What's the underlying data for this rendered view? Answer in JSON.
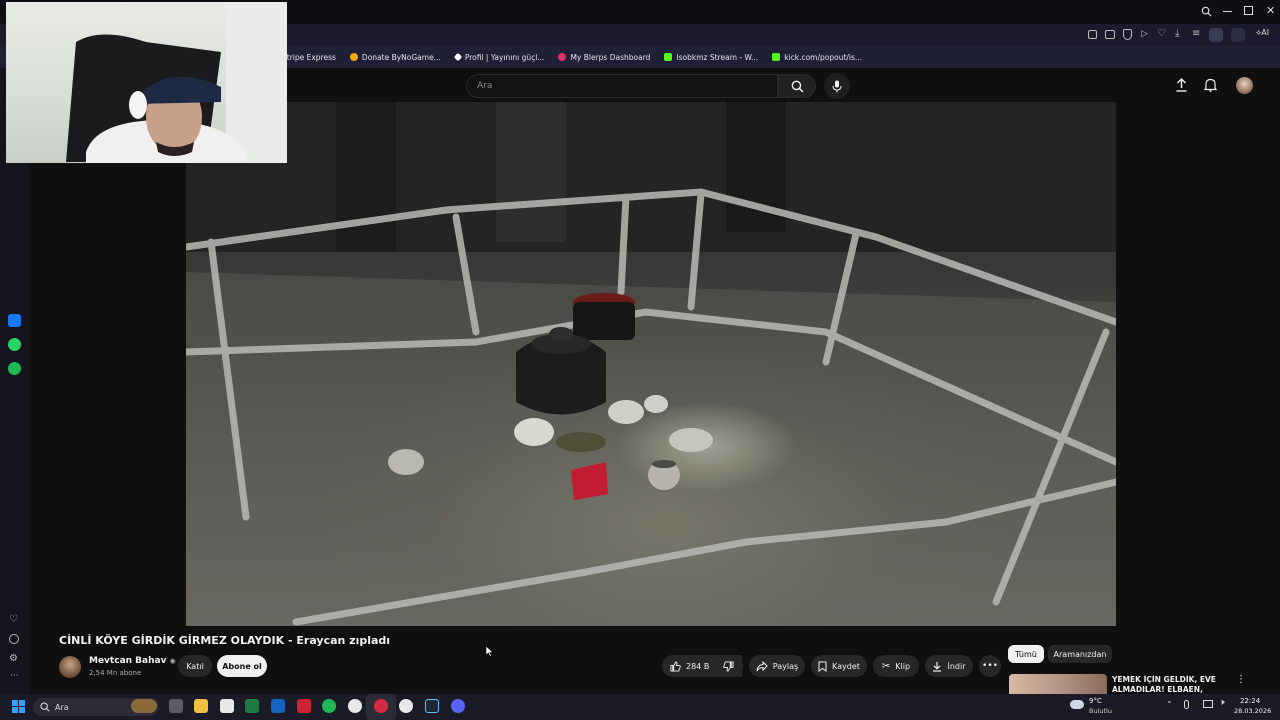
{
  "bookmarks": [
    {
      "label": "Stripe Express",
      "icon": "stripe-icon",
      "color": "#635bff"
    },
    {
      "label": "Donate ByNoGame...",
      "icon": "bynogame-icon",
      "color": "#f2a900"
    },
    {
      "label": "Profil | Yayınını güçl...",
      "icon": "profile-icon",
      "color": "#ffffff"
    },
    {
      "label": "My Blerps Dashboard",
      "icon": "blerp-icon",
      "color": "#e0306a"
    },
    {
      "label": "Isobkmz Stream - W...",
      "icon": "kick-icon",
      "color": "#53fc18"
    },
    {
      "label": "kick.com/popout/is...",
      "icon": "kick-icon",
      "color": "#53fc18"
    }
  ],
  "search": {
    "placeholder": "Ara"
  },
  "video": {
    "title": "CİNLİ KÖYE GİRDİK GİRMEZ OLAYDIK - Eraycan zıpladı"
  },
  "channel": {
    "name": "Mevtcan Bahav",
    "subscribers": "2,54 Mn abone",
    "join_label": "Katıl",
    "subscribe_label": "Abone ol"
  },
  "actions": {
    "likes": "284 B",
    "share": "Paylaş",
    "save": "Kaydet",
    "clip": "Klip",
    "download": "İndir"
  },
  "chips": {
    "all": "Tümü",
    "from_search": "Aramanızdan"
  },
  "recommendation": {
    "title": "YEMEK İÇİN GELDİK, EVE ALMADILAR! ELBAEN, ERAY..."
  },
  "taskbar": {
    "search_label": "Ara",
    "weather_temp": "9°C",
    "weather_desc": "Bulutlu",
    "time": "22:24",
    "date": "28.03.2026"
  },
  "colors": {
    "accent": "#f1f1f1",
    "background": "#0f0f0f",
    "browser_toolbar": "#1b1b2d"
  }
}
